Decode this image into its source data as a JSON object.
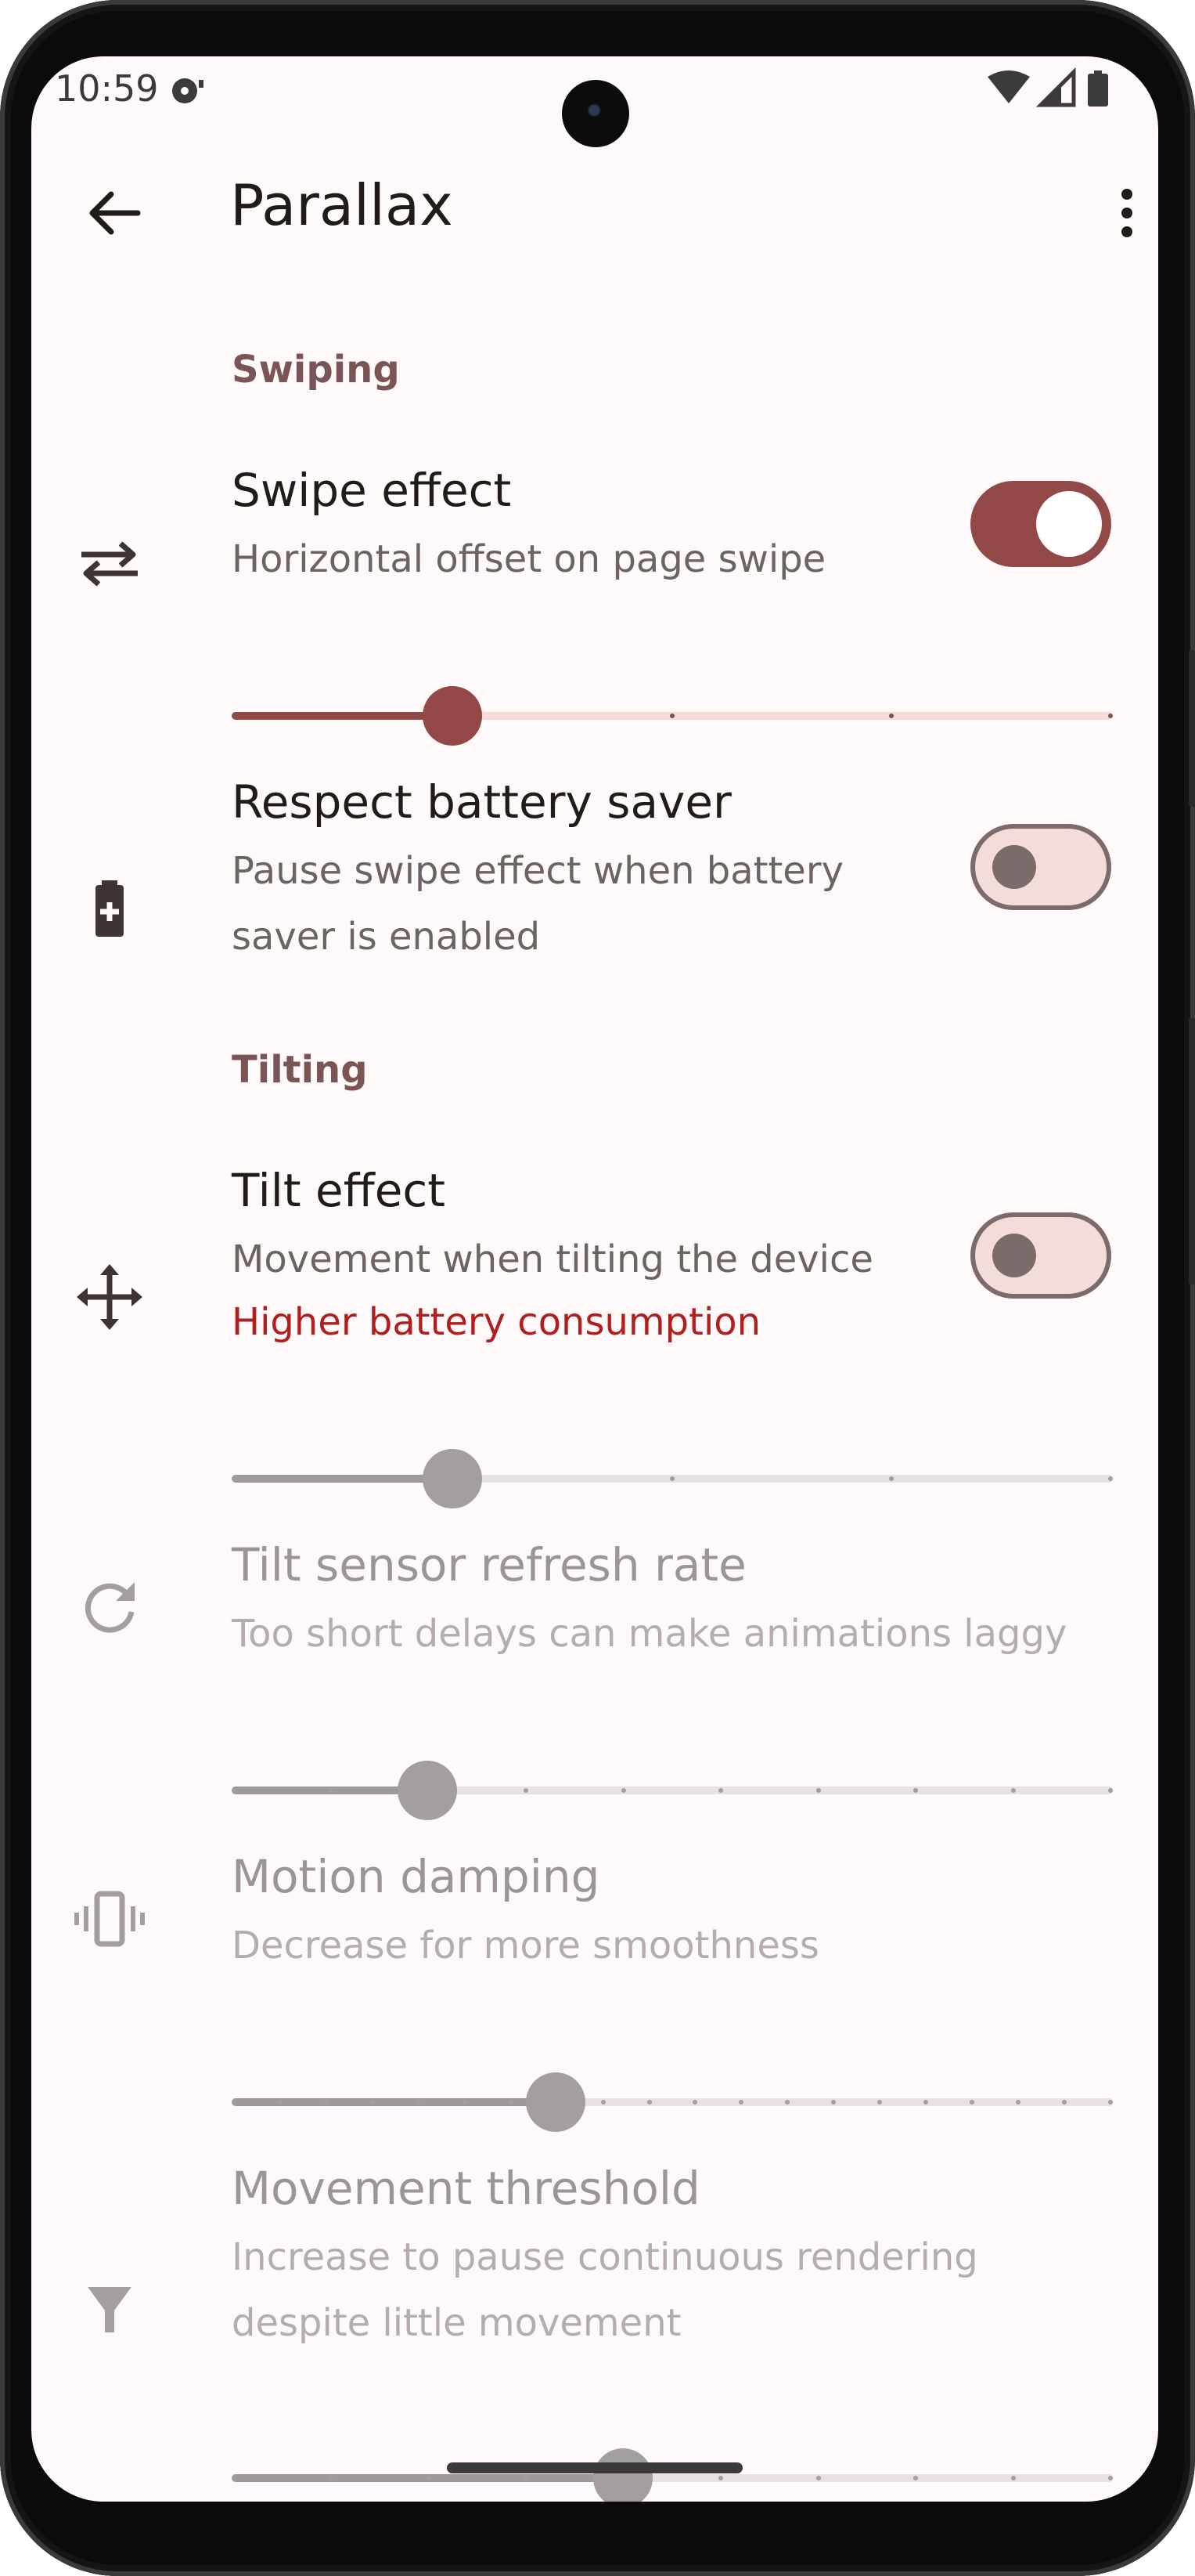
{
  "status_bar": {
    "time": "10:59"
  },
  "app_bar": {
    "title": "Parallax"
  },
  "sections": [
    {
      "title": "Swiping"
    },
    {
      "title": "Tilting"
    }
  ],
  "items": {
    "swipe_effect": {
      "title": "Swipe effect",
      "subtitle": "Horizontal offset on page swipe",
      "enabled": true,
      "slider_fraction": 0.25,
      "slider_steps": 4
    },
    "battery_saver": {
      "title": "Respect battery saver",
      "subtitle_line1": "Pause swipe effect when battery",
      "subtitle_line2": "saver is enabled",
      "enabled": false
    },
    "tilt_effect": {
      "title": "Tilt effect",
      "subtitle": "Movement when tilting the device",
      "warning": "Higher battery consumption",
      "enabled": false,
      "slider_fraction": 0.25,
      "slider_steps": 4
    },
    "refresh_rate": {
      "title": "Tilt sensor refresh rate",
      "subtitle": "Too short delays can make animations laggy",
      "slider_fraction": 0.222,
      "slider_steps": 9
    },
    "motion_damping": {
      "title": "Motion damping",
      "subtitle": "Decrease for more smoothness",
      "slider_fraction": 0.368,
      "slider_steps": 19
    },
    "movement_threshold": {
      "title": "Movement threshold",
      "subtitle_line1": "Increase to pause continuous rendering",
      "subtitle_line2": "despite little movement",
      "slider_fraction": 0.444,
      "slider_steps": 9
    }
  },
  "icons": {
    "back": "arrow-left-icon",
    "more": "more-vertical-icon",
    "swipe": "swap-horiz-icon",
    "battery": "battery-plus-icon",
    "tilt": "move-arrows-icon",
    "refresh": "refresh-icon",
    "vibration": "vibration-icon",
    "threshold": "funnel-icon"
  },
  "colors": {
    "accent": "#934848",
    "section_title": "#7b5555",
    "warning": "#b01e1e",
    "background": "#fff9f9"
  }
}
